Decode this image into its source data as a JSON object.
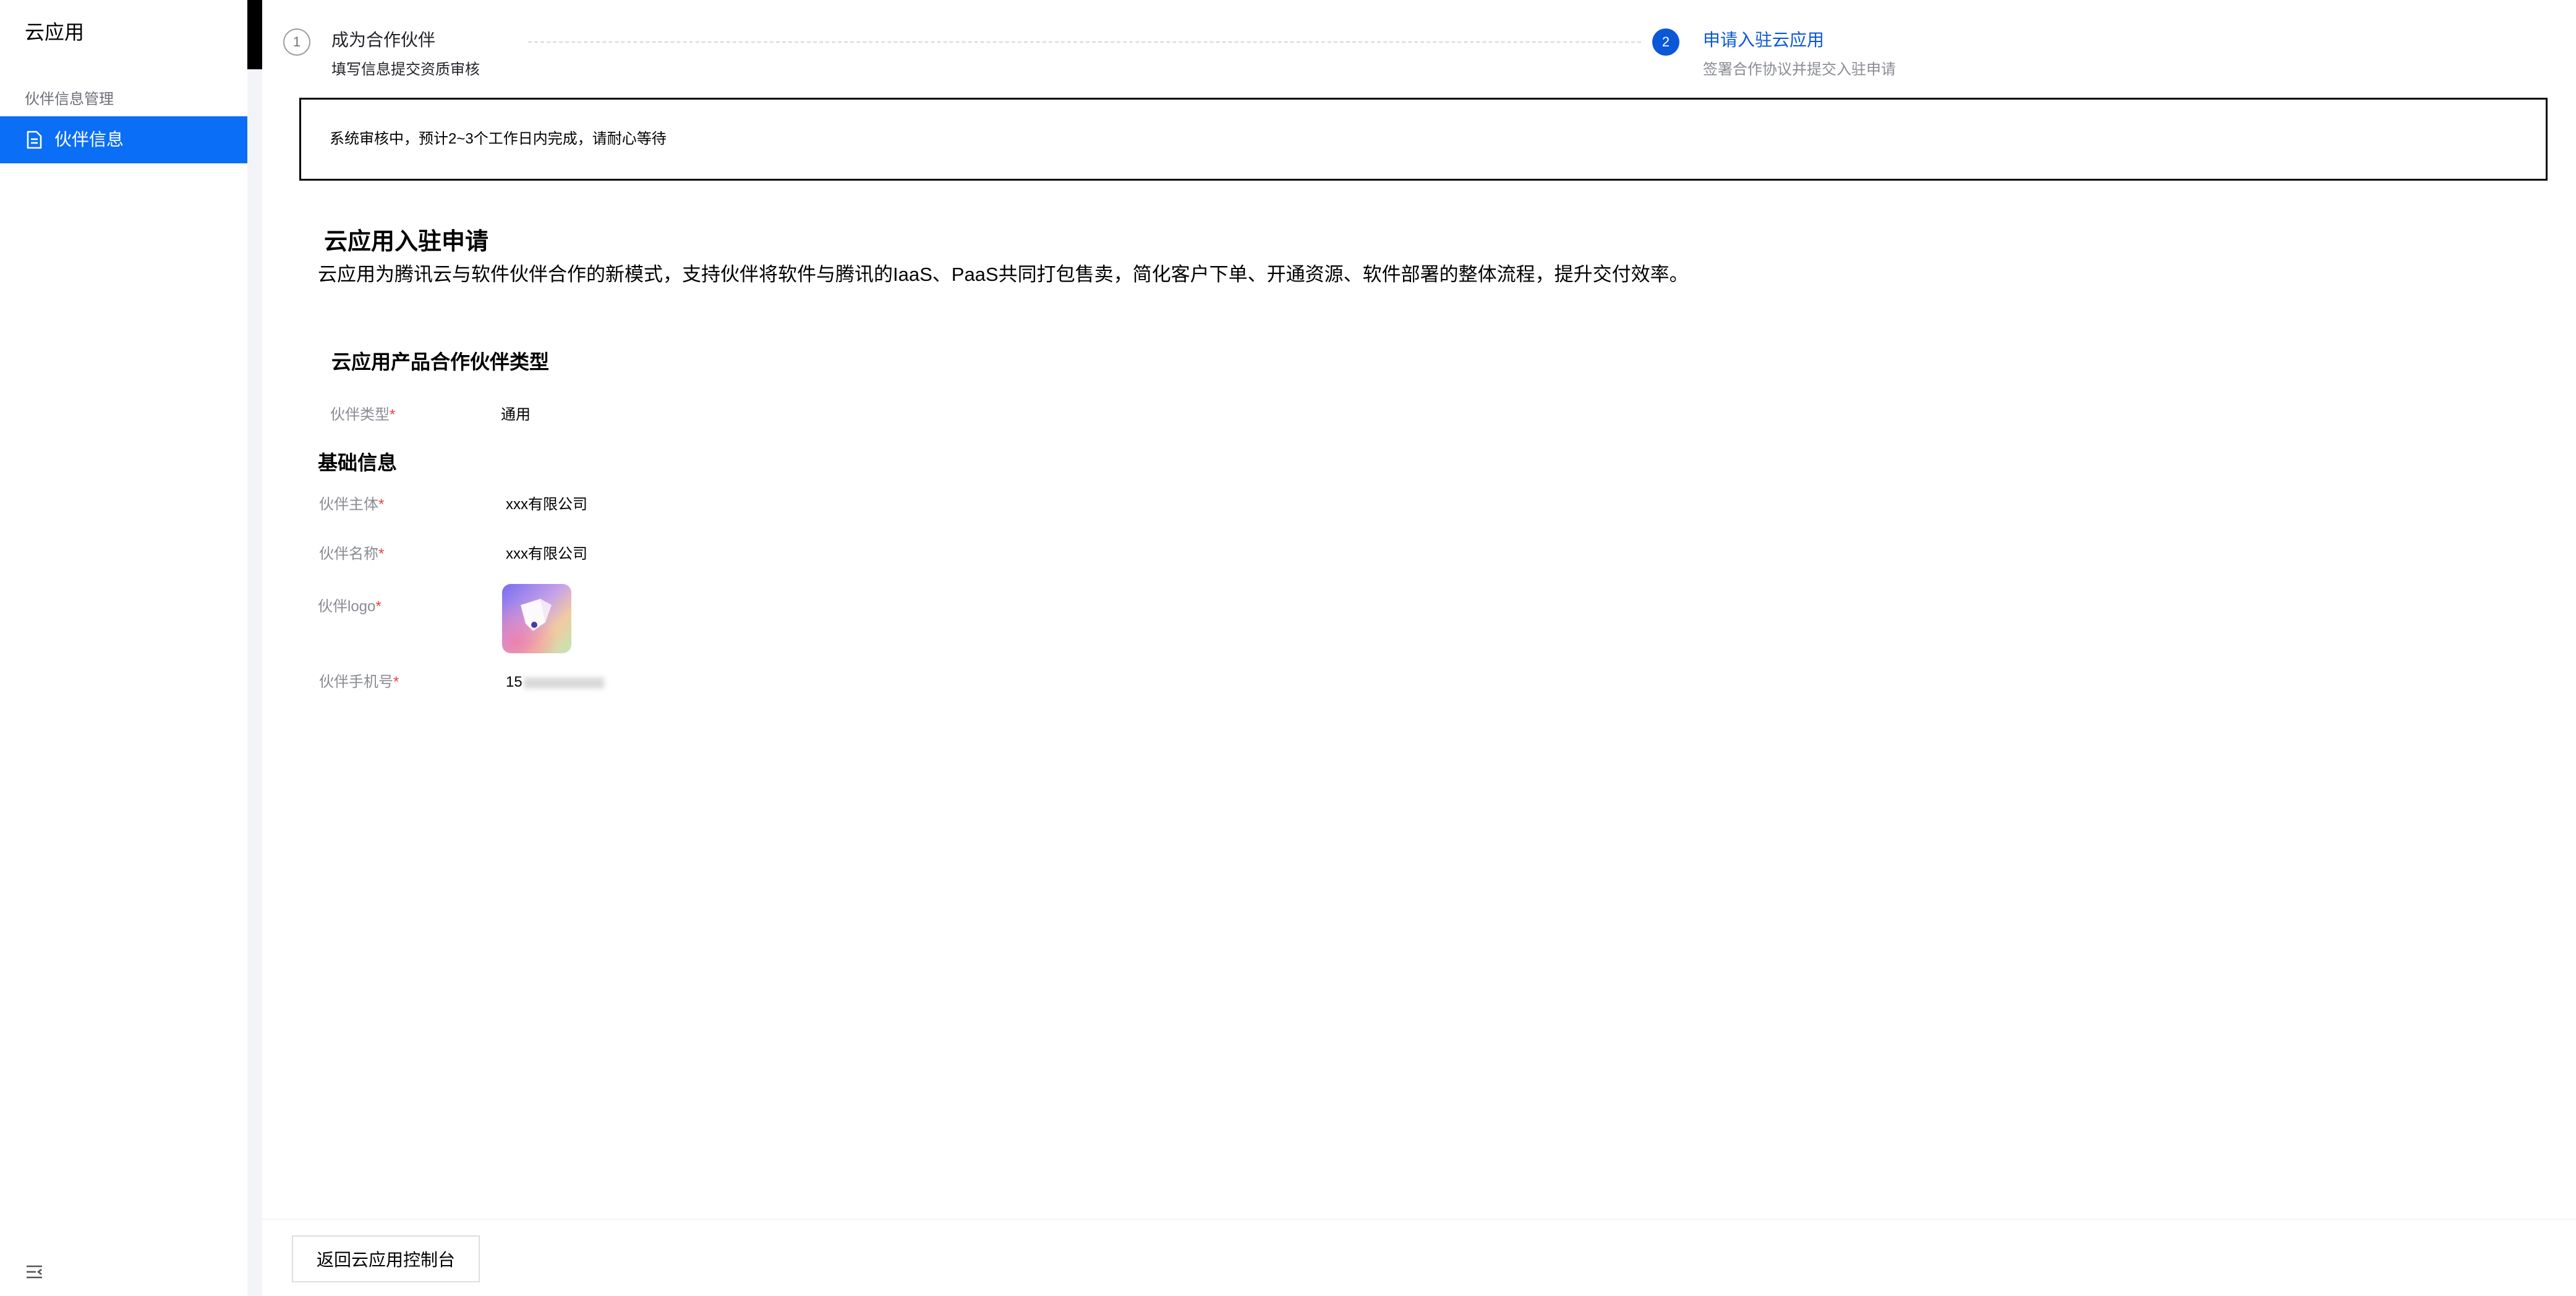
{
  "sidebar": {
    "app_title": "云应用",
    "group_label": "伙伴信息管理",
    "items": [
      {
        "label": "伙伴信息",
        "icon": "document-icon",
        "active": true
      }
    ],
    "collapse_icon": "menu-collapse-icon"
  },
  "steps": [
    {
      "number": "1",
      "title": "成为合作伙伴",
      "description": "填写信息提交资质审核",
      "status": "done"
    },
    {
      "number": "2",
      "title": "申请入驻云应用",
      "description": "签署合作协议并提交入驻申请",
      "status": "current"
    }
  ],
  "notice": {
    "text": "系统审核中，预计2~3个工作日内完成，请耐心等待"
  },
  "application": {
    "heading": "云应用入驻申请",
    "intro": "云应用为腾讯云与软件伙伴合作的新模式，支持伙伴将软件与腾讯的IaaS、PaaS共同打包售卖，简化客户下单、开通资源、软件部署的整体流程，提升交付效率。",
    "partner_type_section": {
      "heading": "云应用产品合作伙伴类型",
      "label": "伙伴类型",
      "required_mark": "*",
      "value": "通用"
    },
    "basic_info": {
      "heading": "基础信息",
      "fields": {
        "entity": {
          "label": "伙伴主体",
          "required_mark": "*",
          "value": "xxx有限公司"
        },
        "name": {
          "label": "伙伴名称",
          "required_mark": "*",
          "value": "xxx有限公司"
        },
        "logo": {
          "label": "伙伴logo",
          "required_mark": "*"
        },
        "phone": {
          "label": "伙伴手机号",
          "required_mark": "*",
          "value_visible": "15"
        }
      }
    }
  },
  "footer": {
    "back_button": "返回云应用控制台"
  },
  "colors": {
    "primary": "#0a6ef6",
    "step_active": "#0a58d8",
    "required": "#e54545",
    "page_bg": "#f3f4f7"
  }
}
